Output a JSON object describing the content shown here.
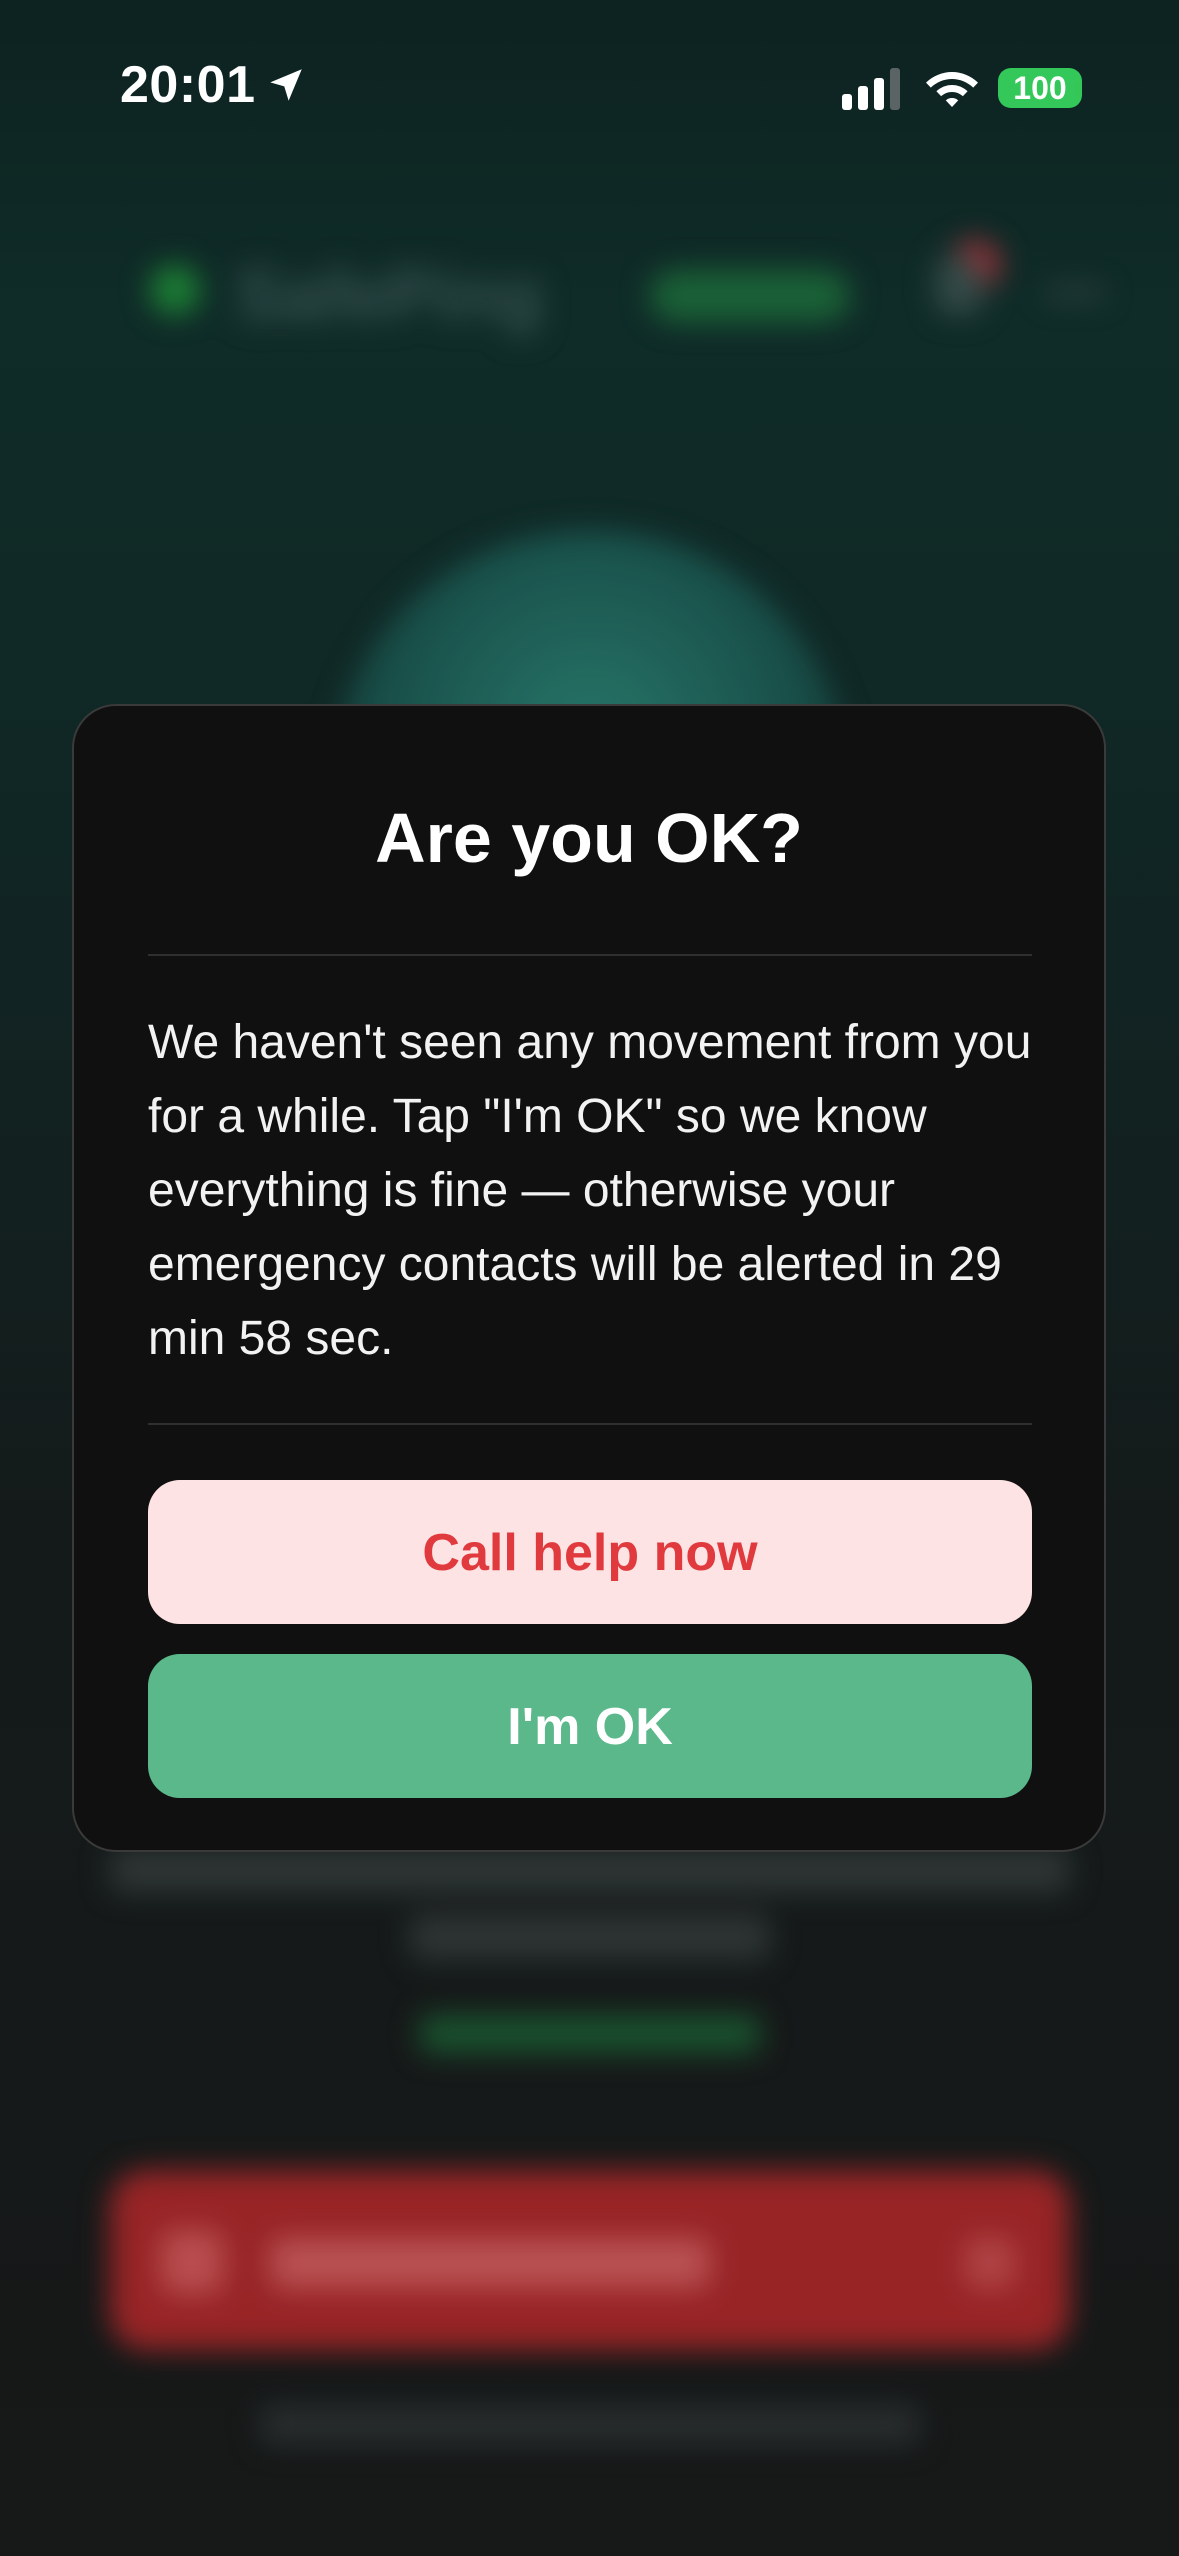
{
  "status_bar": {
    "time": "20:01",
    "battery_level": "100",
    "icons": [
      "location-arrow-icon",
      "cellular-signal-icon",
      "wifi-icon",
      "battery-icon"
    ],
    "battery_color": "#34c759"
  },
  "modal": {
    "title": "Are you OK?",
    "message": "We haven't seen any movement from you for a while. Tap \"I'm OK\" so we know everything is fine — otherwise your emergency contacts will be alerted in 29 min 58 sec.",
    "call_help_label": "Call help now",
    "im_ok_label": "I'm OK"
  },
  "colors": {
    "call_help_bg": "#fde3e3",
    "call_help_text": "#e03a3e",
    "im_ok_bg": "#5bb88a",
    "modal_bg": "#101010"
  }
}
